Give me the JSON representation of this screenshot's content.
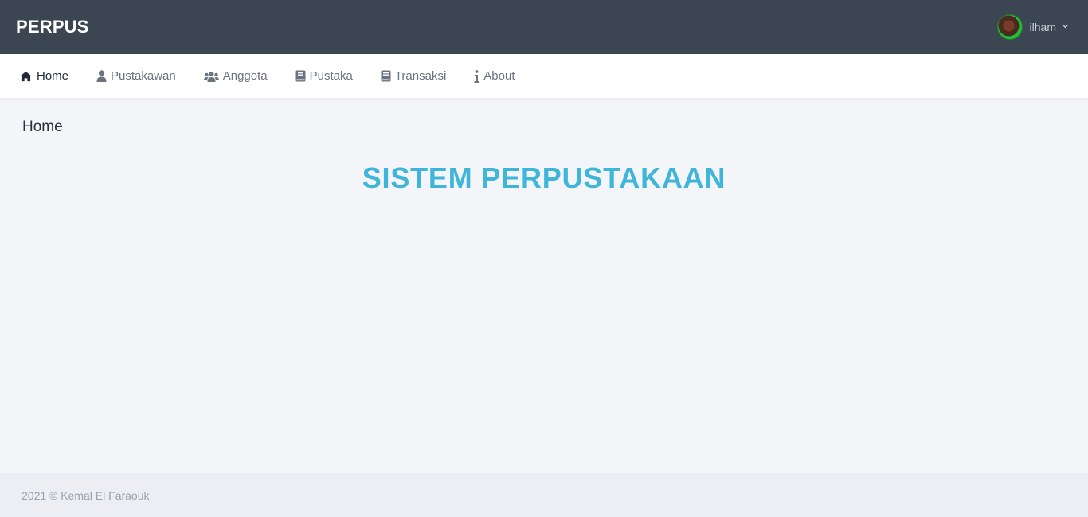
{
  "header": {
    "brand": "PERPUS",
    "user": {
      "name": "ilham"
    }
  },
  "nav": {
    "items": [
      {
        "label": "Home",
        "icon": "home-icon",
        "active": true
      },
      {
        "label": "Pustakawan",
        "icon": "user-icon",
        "active": false
      },
      {
        "label": "Anggota",
        "icon": "users-icon",
        "active": false
      },
      {
        "label": "Pustaka",
        "icon": "book-icon",
        "active": false
      },
      {
        "label": "Transaksi",
        "icon": "book-icon",
        "active": false
      },
      {
        "label": "About",
        "icon": "info-icon",
        "active": false
      }
    ]
  },
  "main": {
    "page_title": "Home",
    "hero_title": "SISTEM PERPUSTAKAAN"
  },
  "footer": {
    "text": "2021 © Kemal El Faraouk"
  },
  "colors": {
    "topbar": "#3c4653",
    "accent": "#3fb5d9",
    "background": "#f4f5f9"
  }
}
